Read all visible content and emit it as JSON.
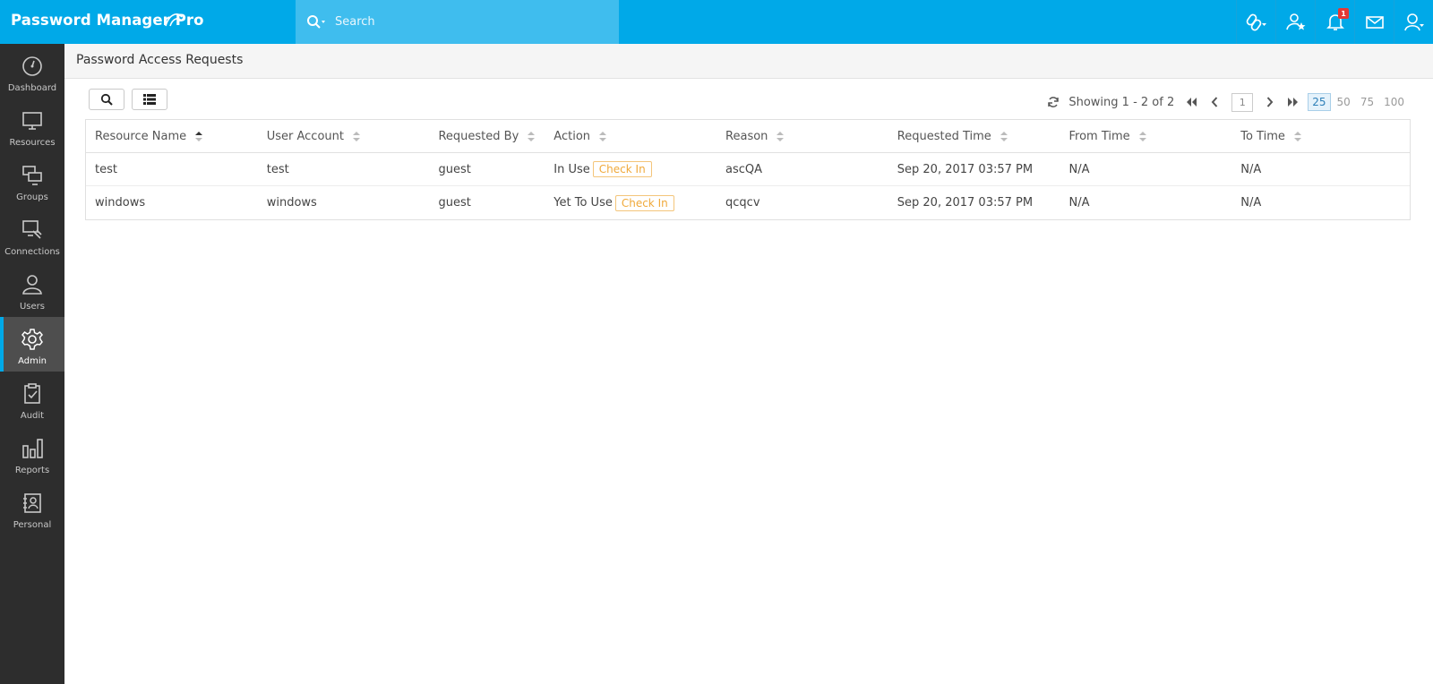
{
  "app": {
    "logo_text": "Password Manager Pro"
  },
  "search": {
    "placeholder": "Search"
  },
  "notifications": {
    "count": "1"
  },
  "sidebar": {
    "items": [
      {
        "label": "Dashboard"
      },
      {
        "label": "Resources"
      },
      {
        "label": "Groups"
      },
      {
        "label": "Connections"
      },
      {
        "label": "Users"
      },
      {
        "label": "Admin"
      },
      {
        "label": "Audit"
      },
      {
        "label": "Reports"
      },
      {
        "label": "Personal"
      }
    ],
    "active": "Admin"
  },
  "page": {
    "title": "Password Access Requests"
  },
  "pager": {
    "showing": "Showing 1 - 2 of 2",
    "current_page": "1",
    "sizes": [
      "25",
      "50",
      "75",
      "100"
    ],
    "selected_size": "25"
  },
  "table": {
    "columns": [
      "Resource Name",
      "User Account",
      "Requested By",
      "Action",
      "Reason",
      "Requested Time",
      "From Time",
      "To Time"
    ],
    "rows": [
      {
        "resource": "test",
        "account": "test",
        "requested_by": "guest",
        "status": "In Use",
        "action_button": "Check In",
        "reason": "ascQA",
        "requested_time": "Sep 20, 2017 03:57 PM",
        "from_time": "N/A",
        "to_time": "N/A"
      },
      {
        "resource": "windows",
        "account": "windows",
        "requested_by": "guest",
        "status": "Yet To Use",
        "action_button": "Check In",
        "reason": "qcqcv",
        "requested_time": "Sep 20, 2017 03:57 PM",
        "from_time": "N/A",
        "to_time": "N/A"
      }
    ]
  },
  "colors": {
    "topbar": "#00a9e8",
    "search_bg": "#3fbdee",
    "sidebar": "#2d2d2d",
    "sidebar_active": "#4e4e4e",
    "checkin": "#f0a93a"
  }
}
